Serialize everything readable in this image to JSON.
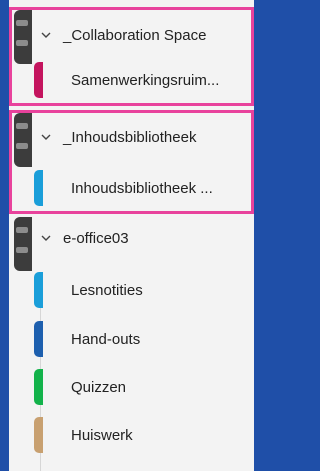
{
  "notebooks": [
    {
      "name": "_Collaboration Space",
      "highlighted": true,
      "sections": [
        {
          "label": "Samenwerkingsruim...",
          "color": "#c4145e"
        }
      ]
    },
    {
      "name": "_Inhoudsbibliotheek",
      "highlighted": true,
      "sections": [
        {
          "label": "Inhoudsbibliotheek ...",
          "color": "#1a9ed9"
        }
      ]
    },
    {
      "name": "e-office03",
      "highlighted": false,
      "sections": [
        {
          "label": "Lesnotities",
          "color": "#1a9ed9"
        },
        {
          "label": "Hand-outs",
          "color": "#1d5fae"
        },
        {
          "label": "Quizzen",
          "color": "#12b24a"
        },
        {
          "label": "Huiswerk",
          "color": "#c8a070"
        }
      ]
    }
  ],
  "colors": {
    "highlight": "#e8429c",
    "background": "#1f4fa8",
    "panel": "#f3f3f3"
  }
}
